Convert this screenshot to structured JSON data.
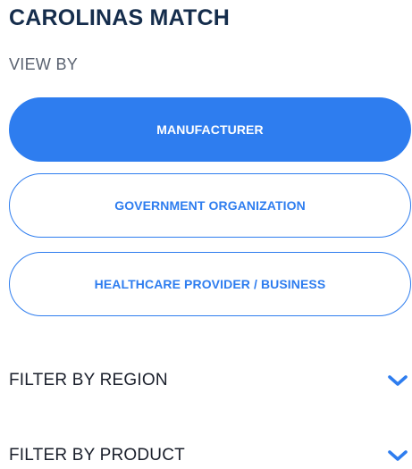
{
  "header": {
    "title": "CAROLINAS MATCH",
    "view_by_label": "VIEW BY"
  },
  "view_options": [
    {
      "label": "MANUFACTURER",
      "selected": true
    },
    {
      "label": "GOVERNMENT ORGANIZATION",
      "selected": false
    },
    {
      "label": "HEALTHCARE PROVIDER / BUSINESS",
      "selected": false
    }
  ],
  "filters": [
    {
      "label": "FILTER BY REGION",
      "icon": "chevron-down-icon"
    },
    {
      "label": "FILTER BY PRODUCT",
      "icon": "chevron-down-icon"
    }
  ],
  "colors": {
    "accent": "#2e7def",
    "title": "#152d4c",
    "muted": "#5a6270",
    "text": "#1a1f2b"
  }
}
